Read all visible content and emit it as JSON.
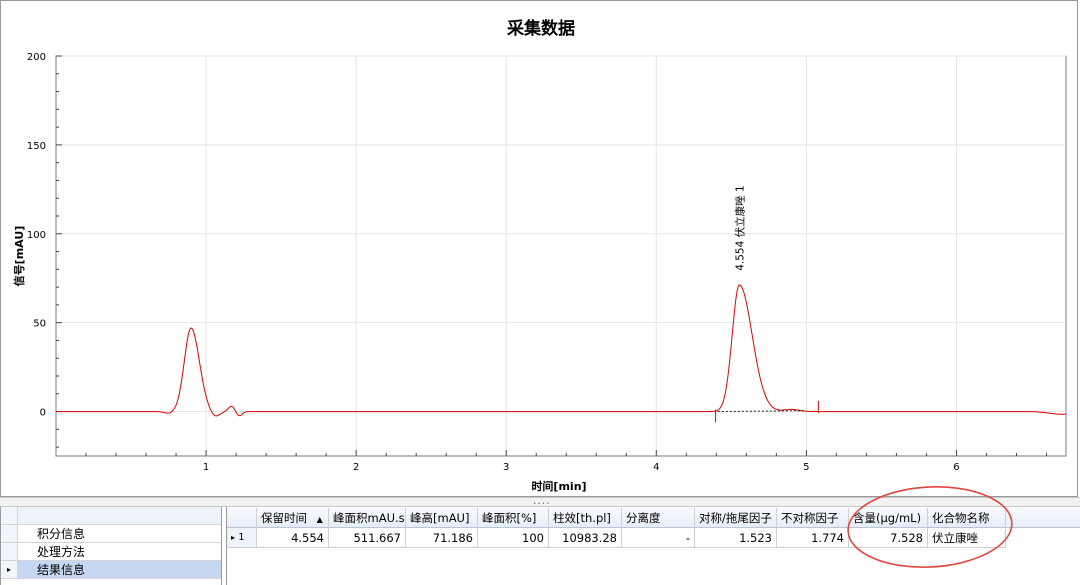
{
  "chart_data": {
    "type": "line",
    "title": "采集数据",
    "xlabel": "时间[min]",
    "ylabel": "信号[mAU]",
    "xlim": [
      0,
      6.73
    ],
    "ylim": [
      -25,
      200
    ],
    "x_ticks": [
      "1",
      "2",
      "3",
      "4",
      "5",
      "6"
    ],
    "y_ticks": [
      "0",
      "50",
      "100",
      "150",
      "200"
    ],
    "grid": true,
    "line_color": "#e00000",
    "peaks": [
      {
        "x": 0.9,
        "y": 47
      },
      {
        "x": 1.17,
        "y": 3
      },
      {
        "x": 4.554,
        "y": 71.186
      }
    ],
    "peak_annotation": {
      "rt": "4.554",
      "name": "伏立康唑",
      "number": "1"
    }
  },
  "nav": {
    "items": [
      {
        "label": "积分信息"
      },
      {
        "label": "处理方法"
      },
      {
        "label": "结果信息"
      }
    ],
    "active_marker": "▸"
  },
  "results": {
    "columns": [
      "保留时间",
      "峰面积mAU.s",
      "峰高[mAU]",
      "峰面积[%]",
      "柱效[th.pl]",
      "分离度",
      "对称/拖尾因子",
      "不对称因子",
      "含量(μg/mL)",
      "化合物名称"
    ],
    "sort_indicator": "▲",
    "rows": [
      {
        "marker": "▸",
        "index": "1",
        "values": [
          "4.554",
          "511.667",
          "71.186",
          "100",
          "10983.28",
          "-",
          "1.523",
          "1.774",
          "7.528",
          "伏立康唑"
        ]
      }
    ]
  },
  "splitter_grip": "....",
  "annotation_color": "#e0473f"
}
